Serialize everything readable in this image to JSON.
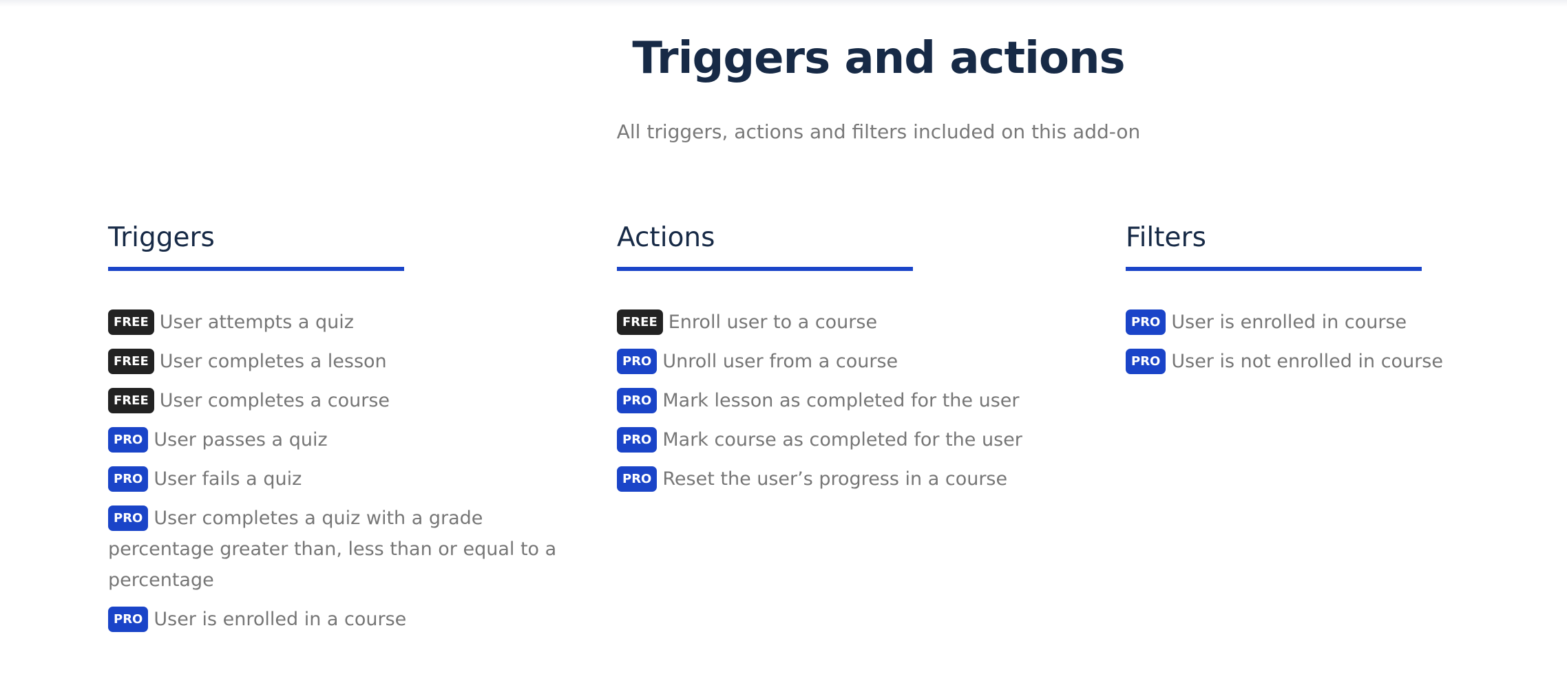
{
  "header": {
    "title": "Triggers and actions",
    "subtitle": "All triggers, actions and filters included on this add-on"
  },
  "colors": {
    "accent": "#1a44c8",
    "free_badge": "#222222",
    "pro_badge": "#1a44c8",
    "heading": "#172a46",
    "body_text": "#767676"
  },
  "badges": {
    "free": "FREE",
    "pro": "PRO"
  },
  "columns": {
    "triggers": {
      "title": "Triggers",
      "items": [
        {
          "badge": "FREE",
          "label": "User attempts a quiz"
        },
        {
          "badge": "FREE",
          "label": "User completes a lesson"
        },
        {
          "badge": "FREE",
          "label": "User completes a course"
        },
        {
          "badge": "PRO",
          "label": "User passes a quiz"
        },
        {
          "badge": "PRO",
          "label": "User fails a quiz"
        },
        {
          "badge": "PRO",
          "label": "User completes a quiz with a grade percentage greater than, less than or equal to a percentage"
        },
        {
          "badge": "PRO",
          "label": "User is enrolled in a course"
        }
      ]
    },
    "actions": {
      "title": "Actions",
      "items": [
        {
          "badge": "FREE",
          "label": "Enroll user to a course"
        },
        {
          "badge": "PRO",
          "label": "Unroll user from a course"
        },
        {
          "badge": "PRO",
          "label": "Mark lesson as completed for the user"
        },
        {
          "badge": "PRO",
          "label": "Mark course as completed for the user"
        },
        {
          "badge": "PRO",
          "label": "Reset the user’s progress in a course"
        }
      ]
    },
    "filters": {
      "title": "Filters",
      "items": [
        {
          "badge": "PRO",
          "label": "User is enrolled in course"
        },
        {
          "badge": "PRO",
          "label": "User is not enrolled in course"
        }
      ]
    }
  }
}
